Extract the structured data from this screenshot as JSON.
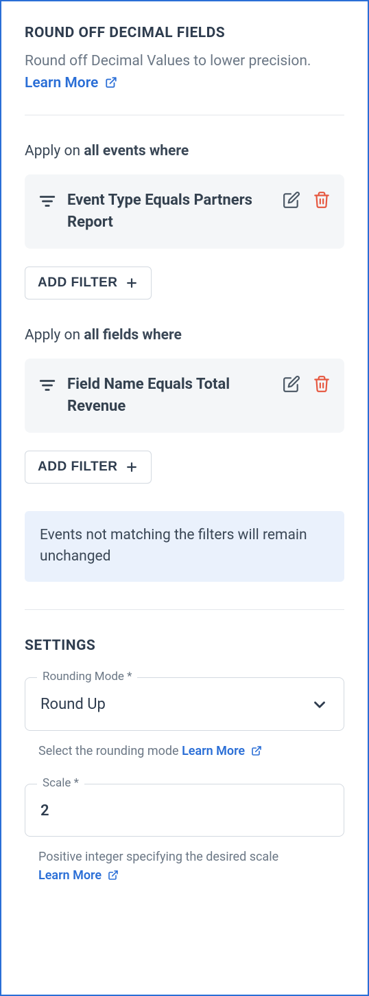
{
  "header": {
    "title": "ROUND OFF DECIMAL FIELDS",
    "description": "Round off Decimal Values to lower precision.",
    "learn_more": "Learn More"
  },
  "events_section": {
    "apply_prefix": "Apply on ",
    "apply_bold": "all events where",
    "filter": "Event Type Equals Partners Report",
    "add_filter": "ADD FILTER"
  },
  "fields_section": {
    "apply_prefix": "Apply on ",
    "apply_bold": "all fields where",
    "filter": "Field Name Equals Total Revenue",
    "add_filter": "ADD FILTER"
  },
  "info_text": "Events not matching the filters will remain unchanged",
  "settings": {
    "title": "SETTINGS",
    "rounding_mode": {
      "label": "Rounding Mode *",
      "value": "Round Up",
      "help": "Select the rounding mode",
      "learn_more": "Learn More"
    },
    "scale": {
      "label": "Scale *",
      "value": "2",
      "help": "Positive integer specifying the desired scale",
      "learn_more": "Learn More"
    }
  },
  "colors": {
    "accent": "#2a6ed6",
    "danger": "#e6573f",
    "text": "#2e3c4e",
    "muted": "#6b7785"
  }
}
